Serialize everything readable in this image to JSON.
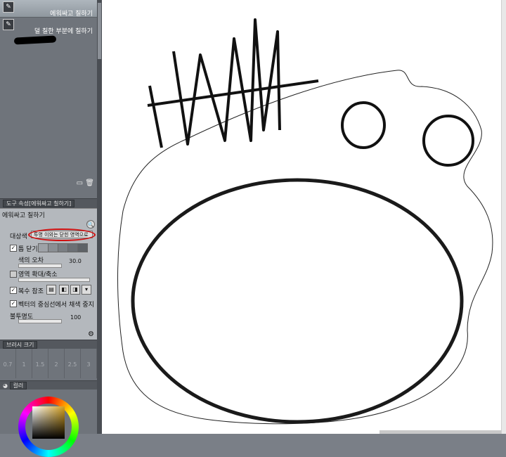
{
  "sub_tools": {
    "items": [
      {
        "label": "에워싸고 칠하기",
        "icon": "fill-lasso-icon",
        "selected": true
      },
      {
        "label": "덜 칠한 부분에 칠하기",
        "icon": "fill-brush-icon",
        "selected": false
      }
    ]
  },
  "tool_property": {
    "header_tab": "도구 속성[에워싸고 칠하기]",
    "title": "에워싸고 칠하기",
    "target_label": "대상색",
    "target_value": "투명 이외는 닫힌 영역으로",
    "gap_close_label": "틈 닫기",
    "gap_close_checked": true,
    "color_margin_label": "색의 오차",
    "color_margin_value": "30.0",
    "expand_label": "영역 확대/축소",
    "expand_checked": false,
    "multi_ref_label": "복수 참조",
    "multi_ref_checked": true,
    "vector_stop_label": "벡터의 중심선에서 채색 중지",
    "vector_stop_checked": true,
    "opacity_label": "불투명도",
    "opacity_value": "100"
  },
  "brush_size": {
    "header_tab": "브러시 크기",
    "sizes": [
      "0.7",
      "1",
      "1.5",
      "2",
      "2.5",
      "3"
    ]
  },
  "color_panel": {
    "header_tab": "컬러",
    "main_color": "#d4a020"
  }
}
